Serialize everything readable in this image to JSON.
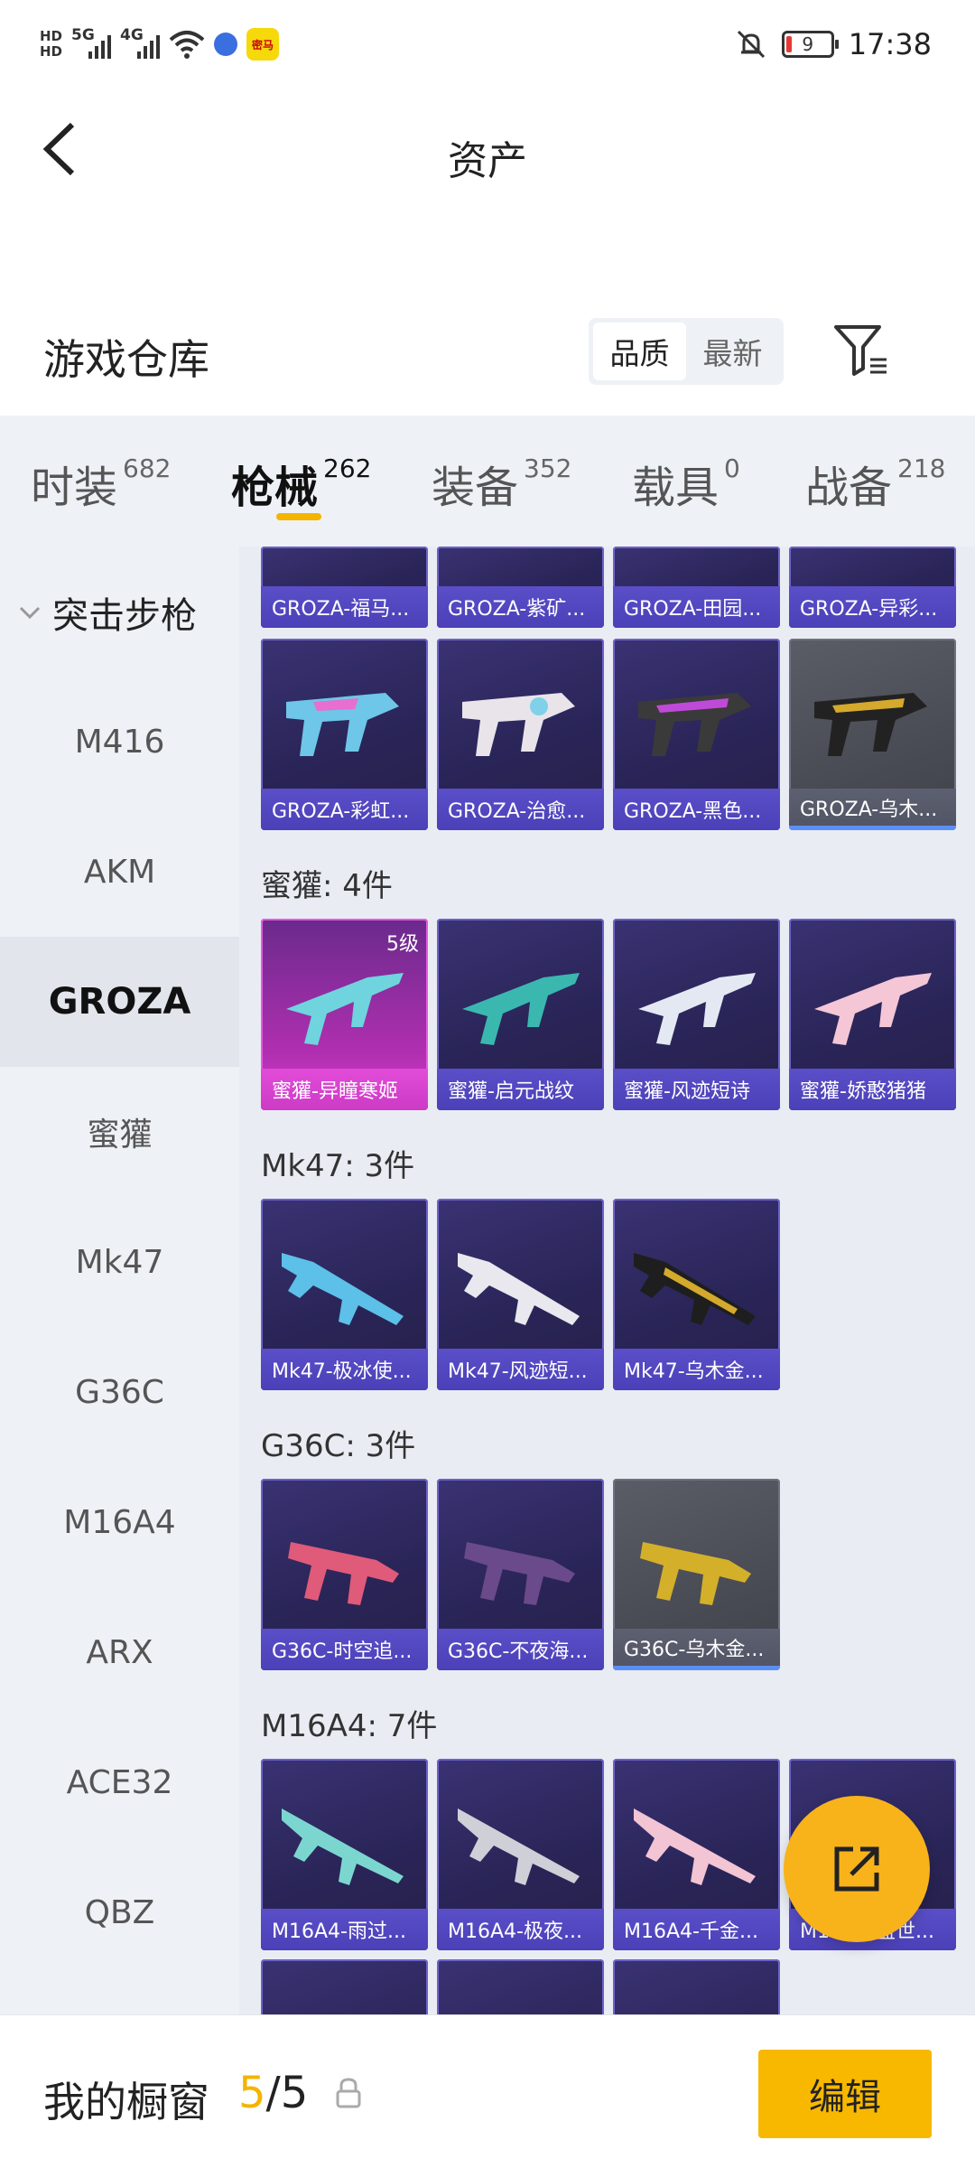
{
  "status_bar": {
    "time": "17:38",
    "battery": "9",
    "network_1": "5G",
    "network_2": "4G",
    "app_badge": "密马"
  },
  "header": {
    "title": "资产"
  },
  "warehouse": {
    "title": "游戏仓库",
    "sort_options": [
      "品质",
      "最新"
    ],
    "sort_selected": "品质"
  },
  "categories": [
    {
      "label": "时装",
      "count": "682"
    },
    {
      "label": "枪械",
      "count": "262"
    },
    {
      "label": "装备",
      "count": "352"
    },
    {
      "label": "载具",
      "count": "0"
    },
    {
      "label": "战备",
      "count": "218"
    }
  ],
  "active_category": "枪械",
  "sidebar": {
    "group": "突击步枪",
    "items": [
      "M416",
      "AKM",
      "GROZA",
      "蜜獾",
      "Mk47",
      "G36C",
      "M16A4",
      "ARX",
      "ACE32",
      "QBZ"
    ],
    "selected": "GROZA"
  },
  "content": {
    "groza_top_row": [
      "GROZA-福马...",
      "GROZA-紫矿...",
      "GROZA-田园...",
      "GROZA-异彩..."
    ],
    "groza_row2": [
      "GROZA-彩虹...",
      "GROZA-治愈...",
      "GROZA-黑色...",
      "GROZA-乌木..."
    ],
    "sections": [
      {
        "title": "蜜獾: 4件",
        "items": [
          "蜜獾-异瞳寒姬",
          "蜜獾-启元战纹",
          "蜜獾-风迹短诗",
          "蜜獾-娇憨猪猪"
        ],
        "first_level": "5级"
      },
      {
        "title": "Mk47: 3件",
        "items": [
          "Mk47-极冰使...",
          "Mk47-风迹短...",
          "Mk47-乌木金..."
        ]
      },
      {
        "title": "G36C: 3件",
        "items": [
          "G36C-时空追...",
          "G36C-不夜海...",
          "G36C-乌木金..."
        ]
      },
      {
        "title": "M16A4: 7件",
        "items": [
          "M16A4-雨过...",
          "M16A4-极夜...",
          "M16A4-千金...",
          "M16A4-盛世..."
        ]
      }
    ]
  },
  "bottom": {
    "showcase_label": "我的橱窗",
    "count_current": "5",
    "count_sep": "/",
    "count_total": "5",
    "edit_label": "编辑"
  },
  "colors": {
    "accent": "#f4b400",
    "card_purple": "#2a2558",
    "card_label": "#5b4fc9"
  },
  "icons": [
    "back-arrow-icon",
    "filter-icon",
    "lock-icon",
    "share-icon",
    "chevron-down-icon"
  ]
}
